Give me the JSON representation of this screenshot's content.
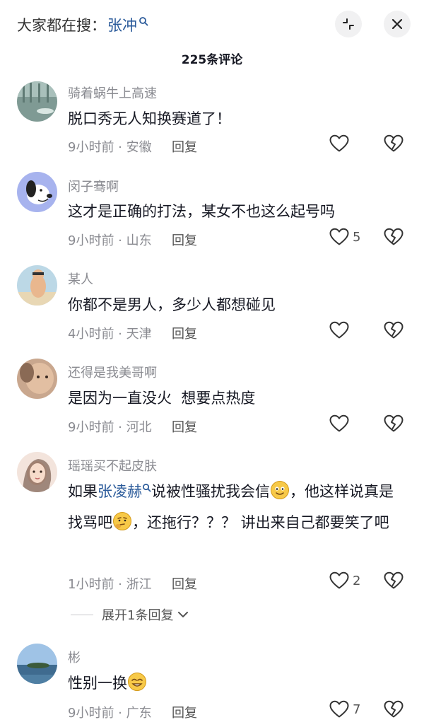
{
  "search": {
    "prefix": "大家都在搜：",
    "keyword": "张冲"
  },
  "header": {
    "count_label": "225条评论"
  },
  "reply_label": "回复",
  "comments": [
    {
      "user": "骑着蜗牛上高速",
      "text": "脱口秀无人知换赛道了！",
      "meta": "9小时前 · 安徽",
      "likes": ""
    },
    {
      "user": "闵子骞啊",
      "text": "这才是正确的打法，某女不也这么起号吗",
      "meta": "9小时前 · 山东",
      "likes": "5"
    },
    {
      "user": "某人",
      "text": "你都不是男人，多少人都想碰见",
      "meta": "4小时前 · 天津",
      "likes": ""
    },
    {
      "user": "还得是我美哥啊",
      "text": "是因为一直没火  想要点热度",
      "meta": "9小时前 · 河北",
      "likes": ""
    },
    {
      "user": "瑶瑶买不起皮肤",
      "text_prefix": "如果",
      "mention": "张凌赫",
      "text_part2": "说被性骚扰我会信",
      "text_part3": "，他这样说真是找骂吧",
      "text_part4": "，还拖行？？？ 讲出来自己都要笑了吧",
      "meta": "1小时前 · 浙江",
      "likes": "2"
    },
    {
      "user": "彬",
      "text": "性别一换",
      "meta": "9小时前 · 广东",
      "likes": "7"
    }
  ],
  "expand": {
    "label": "展开1条回复"
  },
  "colors": {
    "link": "#2a5a9a",
    "muted": "#8a8b91",
    "text": "#161823"
  },
  "icons": {
    "search": "search-icon",
    "collapse": "collapse-icon",
    "close": "close-icon",
    "like": "heart-icon",
    "dislike": "broken-heart-icon"
  }
}
